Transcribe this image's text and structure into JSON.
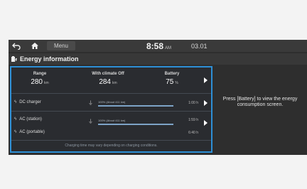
{
  "topbar": {
    "back_icon": "back-arrow-icon",
    "home_icon": "home-icon",
    "menu_label": "Menu",
    "time": "8:58",
    "ampm": "AM",
    "date": "03.01"
  },
  "header": {
    "title": "Energy information",
    "icon": "ev-info-icon"
  },
  "stats": [
    {
      "label": "Range",
      "value": "280",
      "unit": "km"
    },
    {
      "label": "With climate Off",
      "value": "284",
      "unit": "km"
    },
    {
      "label": "Battery",
      "value": "75",
      "unit": "%"
    }
  ],
  "chargers": [
    {
      "label": "DC charger",
      "bar_caption": "100% (About 411 km)",
      "time": "1:00 h"
    },
    {
      "label": "AC (station)",
      "bar_caption": "100% (About 411 km)",
      "time": "1:59 h"
    },
    {
      "label": "AC (portable)",
      "bar_caption": "",
      "time": "6:40 h"
    }
  ],
  "note": "Charging time may vary depending on charging conditions.",
  "side_message": "Press [Battery] to view the energy consumption screen.",
  "colors": {
    "accent": "#2d8fd6",
    "background": "#2e2e2e"
  }
}
